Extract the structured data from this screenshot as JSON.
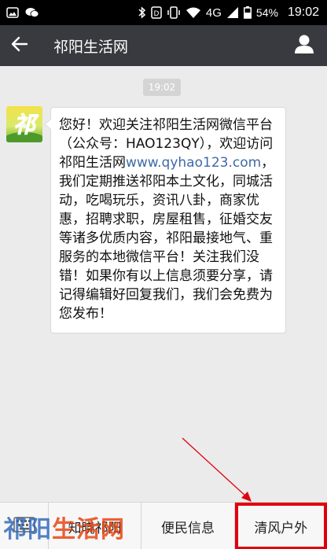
{
  "status_bar": {
    "signal_strength_label": "54%",
    "network_label": "4G",
    "battery_percent": "54%",
    "time": "19:02"
  },
  "action_bar": {
    "title": "祁阳生活网"
  },
  "chat": {
    "timestamp": "19:02",
    "message_part1": "您好！欢迎关注祁阳生活网微信平台（公众号：HAO123QY），欢迎访问祁阳生活网",
    "message_link": "www.qyhao123.com",
    "message_part2": "，我们定期推送祁阳本土文化，同城活动，吃喝玩乐，资讯八卦，商家优惠，招聘求职，房屋租售，征婚交友等诸多优质内容，祁阳最接地气、重服务的本地微信平台！关注我们没错！如果你有以上信息须要分享，请记得编辑好回复我们，我们会免费为您发布！"
  },
  "menu": {
    "items": [
      {
        "label": "知晓祁阳"
      },
      {
        "label": "便民信息"
      },
      {
        "label": "清风户外"
      }
    ]
  },
  "watermark": {
    "part1": "祁阳",
    "part2": "生活网"
  },
  "colors": {
    "action_bar": "#393a3f",
    "highlight": "#e0000e",
    "link": "#3e6aa8"
  }
}
